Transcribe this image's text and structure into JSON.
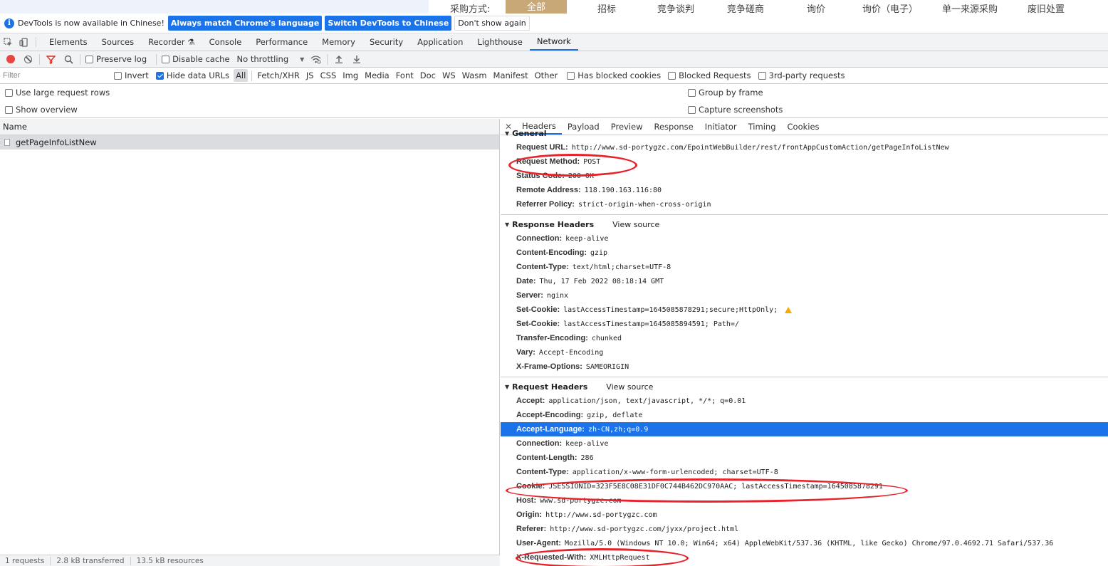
{
  "page_behind": {
    "label": "采购方式:",
    "categories": [
      "全部",
      "招标",
      "竞争谈判",
      "竞争磋商",
      "询价",
      "询价（电子）",
      "单一来源采购",
      "废旧处置"
    ]
  },
  "infobar": {
    "message": "DevTools is now available in Chinese!",
    "btn_match": "Always match Chrome's language",
    "btn_switch": "Switch DevTools to Chinese",
    "btn_dismiss": "Don't show again"
  },
  "tabs": [
    "Elements",
    "Sources",
    "Recorder ⚗",
    "Console",
    "Performance",
    "Memory",
    "Security",
    "Application",
    "Lighthouse",
    "Network"
  ],
  "active_tab": "Network",
  "network_toolbar": {
    "preserve_log": "Preserve log",
    "disable_cache": "Disable cache",
    "throttling": "No throttling"
  },
  "filter": {
    "placeholder": "Filter",
    "invert": "Invert",
    "hide_data_urls": "Hide data URLs",
    "types": [
      "All",
      "Fetch/XHR",
      "JS",
      "CSS",
      "Img",
      "Media",
      "Font",
      "Doc",
      "WS",
      "Wasm",
      "Manifest",
      "Other"
    ],
    "blocked_cookies": "Has blocked cookies",
    "blocked_requests": "Blocked Requests",
    "third_party": "3rd-party requests"
  },
  "settings": {
    "large_rows": "Use large request rows",
    "overview": "Show overview",
    "group_by_frame": "Group by frame",
    "capture_screenshots": "Capture screenshots"
  },
  "request_list": {
    "column_name": "Name",
    "rows": [
      "getPageInfoListNew"
    ],
    "summary": [
      "1 requests",
      "2.8 kB transferred",
      "13.5 kB resources"
    ]
  },
  "details": {
    "tabs": [
      "Headers",
      "Payload",
      "Preview",
      "Response",
      "Initiator",
      "Timing",
      "Cookies"
    ],
    "general_title": "General",
    "general": [
      {
        "k": "Request URL:",
        "v": "http://www.sd-portygzc.com/EpointWebBuilder/rest/frontAppCustomAction/getPageInfoListNew"
      },
      {
        "k": "Request Method:",
        "v": "POST"
      },
      {
        "k": "Status Code:",
        "v": "200 OK"
      },
      {
        "k": "Remote Address:",
        "v": "118.190.163.116:80"
      },
      {
        "k": "Referrer Policy:",
        "v": "strict-origin-when-cross-origin"
      }
    ],
    "response_title": "Response Headers",
    "view_source": "View source",
    "response": [
      {
        "k": "Connection:",
        "v": "keep-alive"
      },
      {
        "k": "Content-Encoding:",
        "v": "gzip"
      },
      {
        "k": "Content-Type:",
        "v": "text/html;charset=UTF-8"
      },
      {
        "k": "Date:",
        "v": "Thu, 17 Feb 2022 08:18:14 GMT"
      },
      {
        "k": "Server:",
        "v": "nginx"
      },
      {
        "k": "Set-Cookie:",
        "v": "lastAccessTimestamp=1645085878291;secure;HttpOnly;"
      },
      {
        "k": "Set-Cookie:",
        "v": "lastAccessTimestamp=1645085894591; Path=/"
      },
      {
        "k": "Transfer-Encoding:",
        "v": "chunked"
      },
      {
        "k": "Vary:",
        "v": "Accept-Encoding"
      },
      {
        "k": "X-Frame-Options:",
        "v": "SAMEORIGIN"
      }
    ],
    "request_title": "Request Headers",
    "request": [
      {
        "k": "Accept:",
        "v": "application/json, text/javascript, */*; q=0.01"
      },
      {
        "k": "Accept-Encoding:",
        "v": "gzip, deflate"
      },
      {
        "k": "Accept-Language:",
        "v": "zh-CN,zh;q=0.9"
      },
      {
        "k": "Connection:",
        "v": "keep-alive"
      },
      {
        "k": "Content-Length:",
        "v": "286"
      },
      {
        "k": "Content-Type:",
        "v": "application/x-www-form-urlencoded; charset=UTF-8"
      },
      {
        "k": "Cookie:",
        "v": "JSESSIONID=323F5E8C08E31DF0C744B462DC970AAC; lastAccessTimestamp=1645085878291"
      },
      {
        "k": "Host:",
        "v": "www.sd-portygzc.com"
      },
      {
        "k": "Origin:",
        "v": "http://www.sd-portygzc.com"
      },
      {
        "k": "Referer:",
        "v": "http://www.sd-portygzc.com/jyxx/project.html"
      },
      {
        "k": "User-Agent:",
        "v": "Mozilla/5.0 (Windows NT 10.0; Win64; x64) AppleWebKit/537.36 (KHTML, like Gecko) Chrome/97.0.4692.71 Safari/537.36"
      },
      {
        "k": "X-Requested-With:",
        "v": "XMLHttpRequest"
      }
    ]
  },
  "colors": {
    "accent": "#1a73e8",
    "annotation": "#e8222a",
    "record": "#e8453c"
  }
}
